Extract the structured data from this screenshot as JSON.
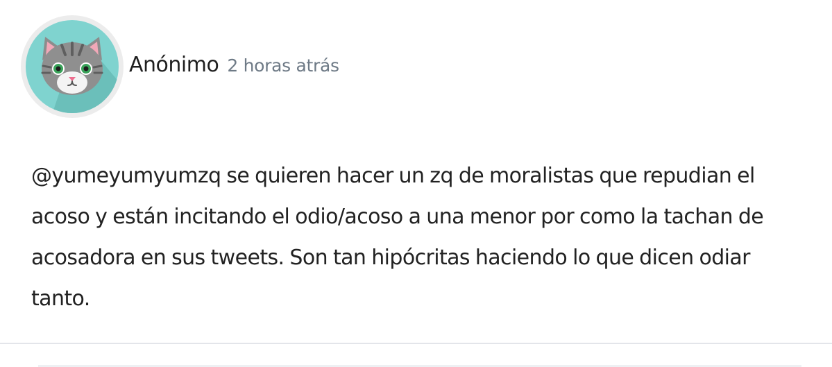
{
  "post": {
    "author": "Anónimo",
    "timestamp": "2 horas atrás",
    "avatar_icon": "cat-avatar-icon",
    "avatar_bg_color": "#7fd3cf",
    "body": "@yumeyumyumzq se quieren hacer un zq de moralistas que repudian el acoso y están incitando el odio/acoso a una menor por como la tachan de acosadora en sus tweets. Son tan hipócritas haciendo lo que dicen odiar tanto."
  }
}
